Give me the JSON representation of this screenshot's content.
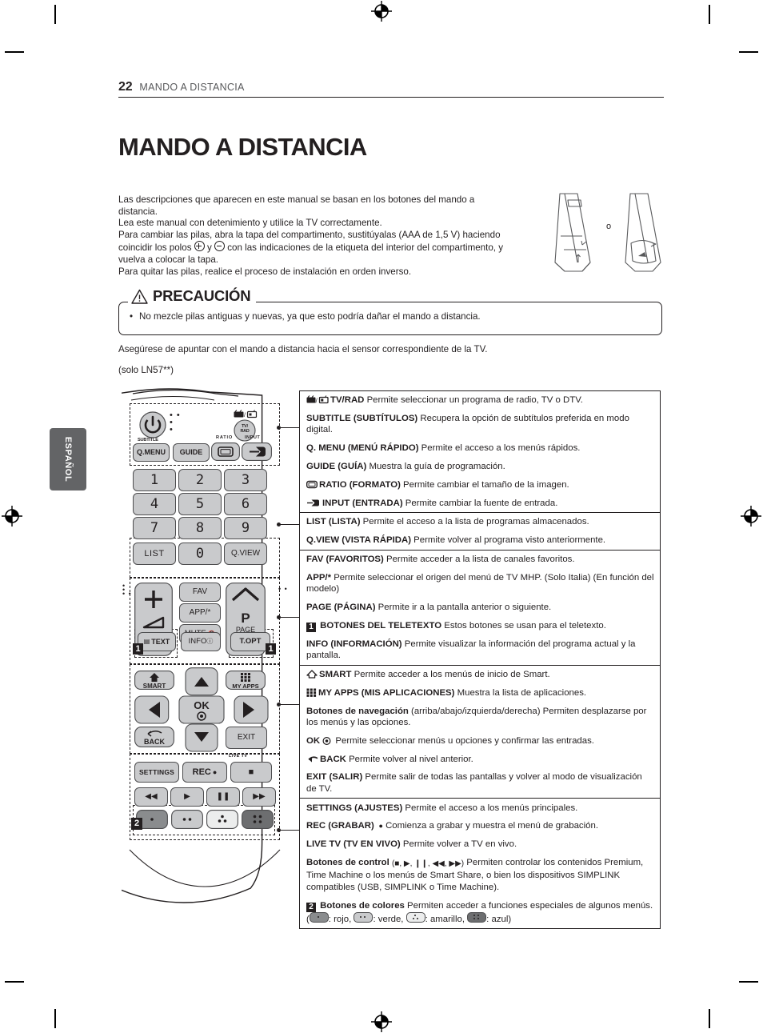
{
  "header": {
    "page_number": "22",
    "section_title": "MANDO A DISTANCIA"
  },
  "main_title": "MANDO A DISTANCIA",
  "intro": {
    "line1": "Las descripciones que aparecen en este manual se basan en los botones del mando a",
    "line2": "distancia.",
    "line3": "Lea este manual con detenimiento y utilice la TV correctamente.",
    "line4": "Para cambiar las pilas, abra la tapa del compartimento, sustitúyalas (AAA de 1,5 V) haciendo",
    "line5a": "coincidir los polos",
    "line5b": "y",
    "line5c": "con las indicaciones de la etiqueta del interior del compartimento, y",
    "line6": "vuelva a colocar la tapa.",
    "line7": "Para quitar las pilas, realice el proceso de instalación en orden inverso."
  },
  "battery_illustration": {
    "separator_label": "o"
  },
  "caution": {
    "title": "PRECAUCIÓN",
    "bullet": "No mezcle pilas antiguas y nuevas, ya que esto podría dañar el mando a distancia."
  },
  "note_pointing": "Asegúrese de apuntar con el mando a distancia hacia el sensor correspondiente de la TV.",
  "note_model": "(solo LN57**)",
  "language_tab": "ESPAÑOL",
  "remote": {
    "buttons": {
      "power": "⏻",
      "tv_rad": "TV/ RAD",
      "subtitle_label": "SUBTITLE",
      "q_menu": "Q.MENU",
      "guide": "GUIDE",
      "ratio_label": "RATIO",
      "input_label": "INPUT",
      "n1": "1",
      "n2": "2",
      "n3": "3",
      "n4": "4",
      "n5": "5",
      "n6": "6",
      "n7": "7",
      "n8": "8",
      "n9": "9",
      "list": "LIST",
      "n0": "0",
      "qview": "Q.VIEW",
      "vol_plus": "+",
      "vol_minus": "—",
      "fav": "FAV",
      "app": "APP/*",
      "mute": "MUTE",
      "p": "P",
      "page": "PAGE",
      "text": "TEXT",
      "info": "INFO",
      "topt": "T.OPT",
      "smart": "SMART",
      "my_apps": "MY APPS",
      "ok": "OK",
      "back": "BACK",
      "exit": "EXIT",
      "live_tv_label": "LIVE TV",
      "settings": "SETTINGS",
      "rec": "REC",
      "stop": "■"
    },
    "callout_badges": [
      "1",
      "1",
      "2"
    ]
  },
  "table": {
    "sections": [
      {
        "rows": [
          {
            "icon": "tv-rad-icon",
            "bold": "TV/RAD",
            "text": " Permite seleccionar un programa de radio, TV o DTV."
          },
          {
            "icon": null,
            "bold": "SUBTITLE (SUBTÍTULOS)",
            "text": " Recupera la opción de subtítulos preferida en modo digital."
          },
          {
            "icon": null,
            "bold": "Q. MENU (MENÚ RÁPIDO)",
            "text": " Permite el acceso a los menús rápidos."
          },
          {
            "icon": null,
            "bold": "GUIDE (GUÍA)",
            "text": " Muestra la guía de programación."
          },
          {
            "icon": "ratio-icon",
            "bold": "RATIO (FORMATO)",
            "text": " Permite cambiar el tamaño de la imagen."
          },
          {
            "icon": "input-icon",
            "bold": "INPUT (ENTRADA)",
            "text": " Permite cambiar la fuente de entrada."
          }
        ]
      },
      {
        "rows": [
          {
            "icon": null,
            "bold": "LIST (LISTA)",
            "text": " Permite el acceso a la lista de programas almacenados."
          },
          {
            "icon": null,
            "bold": "Q.VIEW (VISTA RÁPIDA)",
            "text": " Permite volver al programa visto anteriormente."
          }
        ]
      },
      {
        "rows": [
          {
            "icon": null,
            "bold": "FAV (FAVORITOS)",
            "text": " Permite acceder a la lista de canales favoritos."
          },
          {
            "icon": null,
            "bold": "APP/*",
            "text": " Permite seleccionar el origen del menú de TV MHP. (Solo Italia) (En función del modelo)"
          },
          {
            "icon": null,
            "bold": "PAGE (PÁGINA)",
            "text": " Permite ir a la pantalla anterior o siguiente."
          },
          {
            "icon": "badge-1",
            "bold": "BOTONES DEL TELETEXTO",
            "text": " Estos botones se usan para el teletexto."
          },
          {
            "icon": null,
            "bold": "INFO (INFORMACIÓN)",
            "text": " Permite visualizar la información del programa actual y la pantalla."
          }
        ]
      },
      {
        "rows": [
          {
            "icon": "home-icon",
            "bold": "SMART",
            "text": " Permite acceder a los menús de inicio de Smart."
          },
          {
            "icon": "grid-icon",
            "bold": "MY APPS (MIS APLICACIONES)",
            "text": " Muestra la lista de aplicaciones."
          },
          {
            "icon": null,
            "bold": "Botones de navegación",
            "text": " (arriba/abajo/izquierda/derecha) Permiten desplazarse por los menús y las opciones."
          },
          {
            "icon": null,
            "bold": "OK",
            "text": " Permite seleccionar menús u opciones y confirmar las entradas.",
            "inline_icon": "ok-icon"
          },
          {
            "icon": "back-arrow-icon",
            "bold": "BACK",
            "text": " Permite volver al nivel anterior."
          },
          {
            "icon": null,
            "bold": "EXIT (SALIR)",
            "text": "  Permite salir de todas las pantallas y volver al modo de visualización de TV."
          }
        ]
      },
      {
        "rows": [
          {
            "icon": null,
            "bold": "SETTINGS (AJUSTES)",
            "text": " Permite el acceso a los menús principales."
          },
          {
            "icon": null,
            "bold": "REC (GRABAR)",
            "text": " Comienza a grabar y muestra el menú de grabación.",
            "inline_icon": "rec-dot-icon"
          },
          {
            "icon": null,
            "bold": "LIVE TV (TV EN VIVO)",
            "text": " Permite volver a TV en vivo."
          },
          {
            "icon": null,
            "bold": "Botones de control",
            "text": " Permiten controlar los contenidos Premium, Time Machine o los menús de Smart Share, o bien los dispositivos SIMPLINK compatibles (USB, SIMPLINK o Time Machine).",
            "controls": "(■, ▶, ❙❙, ◀◀, ▶▶)"
          },
          {
            "icon": "badge-2",
            "bold": "Botones de colores",
            "text": " Permiten acceder a funciones especiales de algunos menús. ",
            "color_keys": [
              {
                "key": "red",
                "label": ": rojo, "
              },
              {
                "key": "green",
                "label": ": verde, "
              },
              {
                "key": "yellow",
                "label": ": amarillo, "
              },
              {
                "key": "blue",
                "label": ": azul)"
              }
            ],
            "open_paren": "("
          }
        ]
      }
    ]
  }
}
